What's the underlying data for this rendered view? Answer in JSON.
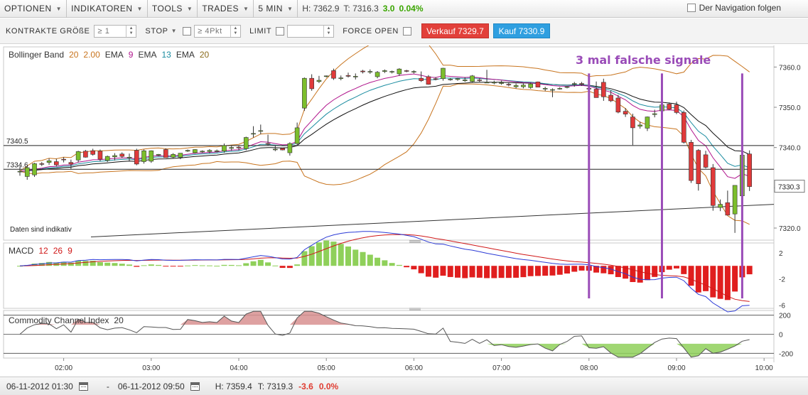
{
  "menu": [
    {
      "label": "OPTIONEN"
    },
    {
      "label": "INDIKATOREN"
    },
    {
      "label": "TOOLS"
    },
    {
      "label": "TRADES"
    },
    {
      "label": "5 MIN"
    }
  ],
  "header_stats": {
    "high": "H: 7362.9",
    "low": "T: 7316.3",
    "change": "3.0",
    "change_pct": "0.04%"
  },
  "nav_follow_label": "Der Navigation folgen",
  "orderbar": {
    "size_label": "KONTRAKTE GRÖßE",
    "size_value": "≥ 1",
    "stop_label": "STOP",
    "stop_value": "≥ 4Pkt",
    "limit_label": "LIMIT",
    "limit_value": "",
    "force_open_label": "FORCE OPEN",
    "sell_button": "Verkauf 7329.7",
    "buy_button": "Kauf 7330.9"
  },
  "panels": {
    "price": {
      "legend": [
        {
          "text": "Bollinger Band",
          "color": "#333333"
        },
        {
          "text": "20",
          "color": "#c8741e"
        },
        {
          "text": "2.00",
          "color": "#c8741e"
        },
        {
          "text": "EMA",
          "color": "#333333"
        },
        {
          "text": "9",
          "color": "#b0148c"
        },
        {
          "text": "EMA",
          "color": "#333333"
        },
        {
          "text": "13",
          "color": "#1a8ca0"
        },
        {
          "text": "EMA",
          "color": "#333333"
        },
        {
          "text": "20",
          "color": "#8a6a1a"
        }
      ],
      "yticks": [
        "7360.0",
        "7350.0",
        "7340.0",
        "7330.0",
        "7320.0"
      ],
      "current_price_label": "7330.3",
      "hline_labels": [
        "7340.5",
        "7334.6"
      ],
      "annotation": "3 mal falsche signale",
      "note": "Daten sind indikativ"
    },
    "macd": {
      "legend": [
        {
          "text": "MACD",
          "color": "#333333"
        },
        {
          "text": "12",
          "color": "#d01818"
        },
        {
          "text": "26",
          "color": "#d01818"
        },
        {
          "text": "9",
          "color": "#d01818"
        }
      ],
      "yticks": [
        "2",
        "-2",
        "-6"
      ]
    },
    "cci": {
      "legend": [
        {
          "text": "Commodity Channel Index",
          "color": "#333333"
        },
        {
          "text": "20",
          "color": "#333333"
        }
      ],
      "yticks": [
        "200",
        "0",
        "-200"
      ]
    }
  },
  "xaxis": {
    "ticks": [
      "02:00",
      "03:00",
      "04:00",
      "05:00",
      "06:00",
      "07:00",
      "08:00",
      "09:00",
      "10:00"
    ]
  },
  "bottombar": {
    "from": "06-11-2012 01:30",
    "separator": "-",
    "to": "06-11-2012 09:50",
    "high": "H: 7359.4",
    "low": "T: 7319.3",
    "change": "-3.6",
    "change_pct": "0.0%"
  },
  "chart_data": {
    "type": "candlestick",
    "interval": "5 MIN",
    "title": "",
    "x_range": [
      "01:30",
      "09:50"
    ],
    "y_range": [
      7317,
      7365
    ],
    "horizontal_lines": [
      7340.5,
      7334.6
    ],
    "current_price": 7330.3,
    "candles": [
      {
        "t": "01:30",
        "o": 7334.1,
        "h": 7335.2,
        "l": 7333.0,
        "c": 7334.1
      },
      {
        "t": "01:35",
        "o": 7332.8,
        "h": 7335.5,
        "l": 7332.0,
        "c": 7335.0
      },
      {
        "t": "01:40",
        "o": 7333.2,
        "h": 7336.2,
        "l": 7332.7,
        "c": 7336.0
      },
      {
        "t": "01:45",
        "o": 7336.0,
        "h": 7336.4,
        "l": 7335.4,
        "c": 7335.9
      },
      {
        "t": "01:50",
        "o": 7336.3,
        "h": 7337.3,
        "l": 7335.7,
        "c": 7336.7
      },
      {
        "t": "01:55",
        "o": 7336.5,
        "h": 7337.2,
        "l": 7335.3,
        "c": 7335.7
      },
      {
        "t": "02:00",
        "o": 7337.1,
        "h": 7337.6,
        "l": 7336.3,
        "c": 7337.0
      },
      {
        "t": "02:05",
        "o": 7336.3,
        "h": 7337.0,
        "l": 7334.7,
        "c": 7335.9
      },
      {
        "t": "02:10",
        "o": 7336.9,
        "h": 7339.2,
        "l": 7336.3,
        "c": 7339.0
      },
      {
        "t": "02:15",
        "o": 7339.1,
        "h": 7339.4,
        "l": 7337.5,
        "c": 7337.6
      },
      {
        "t": "02:20",
        "o": 7339.2,
        "h": 7339.7,
        "l": 7338.0,
        "c": 7338.3
      },
      {
        "t": "02:25",
        "o": 7339.1,
        "h": 7339.5,
        "l": 7336.6,
        "c": 7337.1
      },
      {
        "t": "02:30",
        "o": 7336.8,
        "h": 7338.0,
        "l": 7336.4,
        "c": 7337.8
      },
      {
        "t": "02:35",
        "o": 7337.7,
        "h": 7338.6,
        "l": 7336.8,
        "c": 7338.0
      },
      {
        "t": "02:40",
        "o": 7338.4,
        "h": 7338.8,
        "l": 7337.4,
        "c": 7337.8
      },
      {
        "t": "02:45",
        "o": 7337.4,
        "h": 7338.5,
        "l": 7336.7,
        "c": 7337.6
      },
      {
        "t": "02:50",
        "o": 7339.3,
        "h": 7339.7,
        "l": 7335.6,
        "c": 7335.9
      },
      {
        "t": "02:55",
        "o": 7336.5,
        "h": 7339.5,
        "l": 7336.0,
        "c": 7339.2
      },
      {
        "t": "03:00",
        "o": 7336.6,
        "h": 7339.3,
        "l": 7336.2,
        "c": 7339.2
      },
      {
        "t": "03:05",
        "o": 7338.1,
        "h": 7338.4,
        "l": 7337.9,
        "c": 7338.3
      },
      {
        "t": "03:10",
        "o": 7339.5,
        "h": 7339.8,
        "l": 7337.5,
        "c": 7337.5
      },
      {
        "t": "03:15",
        "o": 7337.6,
        "h": 7338.6,
        "l": 7337.2,
        "c": 7338.3
      },
      {
        "t": "03:20",
        "o": 7337.6,
        "h": 7338.6,
        "l": 7337.1,
        "c": 7338.6
      },
      {
        "t": "03:25",
        "o": 7339.1,
        "h": 7339.5,
        "l": 7338.9,
        "c": 7339.3
      },
      {
        "t": "03:30",
        "o": 7338.7,
        "h": 7339.6,
        "l": 7338.5,
        "c": 7339.5
      },
      {
        "t": "03:35",
        "o": 7338.9,
        "h": 7339.3,
        "l": 7338.7,
        "c": 7339.1
      },
      {
        "t": "03:40",
        "o": 7339.0,
        "h": 7339.6,
        "l": 7338.6,
        "c": 7339.3
      },
      {
        "t": "03:45",
        "o": 7339.1,
        "h": 7339.5,
        "l": 7338.8,
        "c": 7339.2
      },
      {
        "t": "03:50",
        "o": 7339.1,
        "h": 7341.0,
        "l": 7338.7,
        "c": 7340.5
      },
      {
        "t": "03:55",
        "o": 7339.8,
        "h": 7340.4,
        "l": 7339.2,
        "c": 7340.0
      },
      {
        "t": "04:00",
        "o": 7340.1,
        "h": 7340.5,
        "l": 7339.3,
        "c": 7339.9
      },
      {
        "t": "04:05",
        "o": 7339.7,
        "h": 7342.7,
        "l": 7339.3,
        "c": 7342.5
      },
      {
        "t": "04:10",
        "o": 7343.4,
        "h": 7345.3,
        "l": 7342.5,
        "c": 7343.5
      },
      {
        "t": "04:15",
        "o": 7344.2,
        "h": 7345.7,
        "l": 7343.3,
        "c": 7344.2
      },
      {
        "t": "04:20",
        "o": 7341.0,
        "h": 7343.2,
        "l": 7340.5,
        "c": 7340.9
      },
      {
        "t": "04:25",
        "o": 7339.6,
        "h": 7340.4,
        "l": 7339.1,
        "c": 7339.6
      },
      {
        "t": "04:30",
        "o": 7339.8,
        "h": 7339.9,
        "l": 7339.3,
        "c": 7339.4
      },
      {
        "t": "04:35",
        "o": 7338.7,
        "h": 7341.3,
        "l": 7338.0,
        "c": 7341.0
      },
      {
        "t": "04:40",
        "o": 7341.0,
        "h": 7346.2,
        "l": 7340.4,
        "c": 7344.9
      },
      {
        "t": "04:45",
        "o": 7349.8,
        "h": 7357.4,
        "l": 7349.1,
        "c": 7357.2
      },
      {
        "t": "04:50",
        "o": 7357.2,
        "h": 7358.2,
        "l": 7354.1,
        "c": 7354.6
      },
      {
        "t": "04:55",
        "o": 7356.4,
        "h": 7357.8,
        "l": 7356.0,
        "c": 7356.7
      },
      {
        "t": "05:00",
        "o": 7357.8,
        "h": 7357.9,
        "l": 7357.4,
        "c": 7357.8
      },
      {
        "t": "05:05",
        "o": 7359.1,
        "h": 7359.6,
        "l": 7356.8,
        "c": 7357.2
      },
      {
        "t": "05:10",
        "o": 7357.3,
        "h": 7357.9,
        "l": 7356.7,
        "c": 7357.3
      },
      {
        "t": "05:15",
        "o": 7357.9,
        "h": 7358.6,
        "l": 7357.4,
        "c": 7357.7
      },
      {
        "t": "05:20",
        "o": 7357.6,
        "h": 7358.4,
        "l": 7356.9,
        "c": 7357.7
      },
      {
        "t": "05:25",
        "o": 7359.0,
        "h": 7359.3,
        "l": 7358.4,
        "c": 7358.8
      },
      {
        "t": "05:30",
        "o": 7358.8,
        "h": 7359.4,
        "l": 7358.3,
        "c": 7358.9
      },
      {
        "t": "05:35",
        "o": 7357.6,
        "h": 7359.0,
        "l": 7357.2,
        "c": 7358.7
      },
      {
        "t": "05:40",
        "o": 7358.9,
        "h": 7359.4,
        "l": 7358.5,
        "c": 7359.1
      },
      {
        "t": "05:45",
        "o": 7358.8,
        "h": 7359.1,
        "l": 7358.4,
        "c": 7358.9
      },
      {
        "t": "05:50",
        "o": 7358.3,
        "h": 7359.7,
        "l": 7357.8,
        "c": 7359.5
      },
      {
        "t": "05:55",
        "o": 7359.1,
        "h": 7359.3,
        "l": 7358.7,
        "c": 7359.0
      },
      {
        "t": "06:00",
        "o": 7358.9,
        "h": 7359.2,
        "l": 7358.4,
        "c": 7358.9
      },
      {
        "t": "06:05",
        "o": 7357.2,
        "h": 7358.9,
        "l": 7356.3,
        "c": 7356.6
      },
      {
        "t": "06:10",
        "o": 7357.6,
        "h": 7358.0,
        "l": 7355.6,
        "c": 7355.7
      },
      {
        "t": "06:15",
        "o": 7357.1,
        "h": 7357.5,
        "l": 7356.7,
        "c": 7357.0
      },
      {
        "t": "06:20",
        "o": 7357.1,
        "h": 7359.8,
        "l": 7356.6,
        "c": 7359.7
      },
      {
        "t": "06:25",
        "o": 7357.0,
        "h": 7357.3,
        "l": 7356.6,
        "c": 7357.0
      },
      {
        "t": "06:30",
        "o": 7356.9,
        "h": 7357.3,
        "l": 7356.6,
        "c": 7357.1
      },
      {
        "t": "06:35",
        "o": 7356.6,
        "h": 7357.5,
        "l": 7356.3,
        "c": 7356.8
      },
      {
        "t": "06:40",
        "o": 7356.4,
        "h": 7358.0,
        "l": 7356.2,
        "c": 7357.8
      },
      {
        "t": "06:45",
        "o": 7356.8,
        "h": 7357.2,
        "l": 7356.2,
        "c": 7356.7
      },
      {
        "t": "06:50",
        "o": 7356.2,
        "h": 7359.3,
        "l": 7356.0,
        "c": 7356.2
      },
      {
        "t": "06:55",
        "o": 7356.1,
        "h": 7356.6,
        "l": 7355.7,
        "c": 7356.2
      },
      {
        "t": "07:00",
        "o": 7355.9,
        "h": 7356.6,
        "l": 7355.6,
        "c": 7356.1
      },
      {
        "t": "07:05",
        "o": 7355.7,
        "h": 7356.1,
        "l": 7355.2,
        "c": 7355.6
      },
      {
        "t": "07:10",
        "o": 7355.1,
        "h": 7355.9,
        "l": 7354.7,
        "c": 7355.4
      },
      {
        "t": "07:15",
        "o": 7355.1,
        "h": 7355.9,
        "l": 7354.7,
        "c": 7355.5
      },
      {
        "t": "07:20",
        "o": 7354.9,
        "h": 7356.1,
        "l": 7354.6,
        "c": 7355.8
      },
      {
        "t": "07:25",
        "o": 7356.3,
        "h": 7356.4,
        "l": 7355.0,
        "c": 7355.0
      },
      {
        "t": "07:30",
        "o": 7354.6,
        "h": 7355.1,
        "l": 7354.0,
        "c": 7354.7
      },
      {
        "t": "07:35",
        "o": 7354.4,
        "h": 7354.7,
        "l": 7352.5,
        "c": 7354.4
      },
      {
        "t": "07:40",
        "o": 7354.7,
        "h": 7355.0,
        "l": 7354.4,
        "c": 7354.7
      },
      {
        "t": "07:45",
        "o": 7355.1,
        "h": 7355.3,
        "l": 7354.7,
        "c": 7355.1
      },
      {
        "t": "07:50",
        "o": 7355.9,
        "h": 7356.3,
        "l": 7355.1,
        "c": 7355.9
      },
      {
        "t": "07:55",
        "o": 7355.9,
        "h": 7356.3,
        "l": 7355.3,
        "c": 7355.7
      },
      {
        "t": "08:00",
        "o": 7354.7,
        "h": 7355.3,
        "l": 7352.2,
        "c": 7354.6
      },
      {
        "t": "08:05",
        "o": 7354.5,
        "h": 7356.4,
        "l": 7352.4,
        "c": 7352.4
      },
      {
        "t": "08:10",
        "o": 7356.2,
        "h": 7357.1,
        "l": 7351.6,
        "c": 7352.6
      },
      {
        "t": "08:15",
        "o": 7353.0,
        "h": 7354.2,
        "l": 7351.3,
        "c": 7351.6
      },
      {
        "t": "08:20",
        "o": 7352.3,
        "h": 7353.1,
        "l": 7348.5,
        "c": 7348.8
      },
      {
        "t": "08:25",
        "o": 7349.0,
        "h": 7349.8,
        "l": 7347.6,
        "c": 7348.3
      },
      {
        "t": "08:30",
        "o": 7347.6,
        "h": 7348.4,
        "l": 7340.6,
        "c": 7344.9
      },
      {
        "t": "08:35",
        "o": 7345.3,
        "h": 7346.4,
        "l": 7344.7,
        "c": 7345.6
      },
      {
        "t": "08:40",
        "o": 7344.8,
        "h": 7347.7,
        "l": 7344.1,
        "c": 7347.6
      },
      {
        "t": "08:45",
        "o": 7348.2,
        "h": 7349.4,
        "l": 7347.5,
        "c": 7348.4
      },
      {
        "t": "08:50",
        "o": 7349.1,
        "h": 7350.8,
        "l": 7348.0,
        "c": 7350.6
      },
      {
        "t": "08:55",
        "o": 7350.8,
        "h": 7351.2,
        "l": 7349.3,
        "c": 7349.5
      },
      {
        "t": "09:00",
        "o": 7350.6,
        "h": 7351.4,
        "l": 7348.3,
        "c": 7348.7
      },
      {
        "t": "09:05",
        "o": 7348.7,
        "h": 7349.2,
        "l": 7341.0,
        "c": 7341.3
      },
      {
        "t": "09:10",
        "o": 7341.3,
        "h": 7341.9,
        "l": 7331.2,
        "c": 7331.8
      },
      {
        "t": "09:15",
        "o": 7339.3,
        "h": 7339.6,
        "l": 7329.3,
        "c": 7331.0
      },
      {
        "t": "09:20",
        "o": 7338.2,
        "h": 7339.2,
        "l": 7334.8,
        "c": 7335.1
      },
      {
        "t": "09:25",
        "o": 7335.0,
        "h": 7335.9,
        "l": 7324.3,
        "c": 7325.6
      },
      {
        "t": "09:30",
        "o": 7325.1,
        "h": 7327.1,
        "l": 7324.2,
        "c": 7325.9
      },
      {
        "t": "09:35",
        "o": 7326.3,
        "h": 7329.3,
        "l": 7323.2,
        "c": 7323.2
      },
      {
        "t": "09:40",
        "o": 7323.5,
        "h": 7329.7,
        "l": 7318.8,
        "c": 7330.6
      },
      {
        "t": "09:45",
        "o": 7328.0,
        "h": 7331.8,
        "l": 7325.1,
        "c": 7338.1
      },
      {
        "t": "09:50",
        "o": 7338.4,
        "h": 7339.3,
        "l": 7329.2,
        "c": 7330.3
      }
    ],
    "indicators": [
      {
        "name": "Bollinger Band",
        "params": [
          20,
          2.0
        ]
      },
      {
        "name": "EMA",
        "params": [
          9
        ]
      },
      {
        "name": "EMA",
        "params": [
          13
        ]
      },
      {
        "name": "EMA",
        "params": [
          20
        ]
      },
      {
        "name": "MACD",
        "params": [
          12,
          26,
          9
        ],
        "y_range": [
          -6.5,
          3.5
        ]
      },
      {
        "name": "Commodity Channel Index",
        "params": [
          20
        ],
        "y_range": [
          -250,
          250
        ],
        "ref_lines": [
          200,
          0,
          -200
        ]
      }
    ],
    "colors": {
      "bullish": "#7cbe2c",
      "bearish": "#e03a3a",
      "bollinger": "#c8741e",
      "ema9": "#b0148c",
      "ema13": "#1a8ca0",
      "ema20": "#8a6a1a",
      "macd_line": "#2b3ad6",
      "signal_line": "#d01818",
      "cci_pos": "#d89090",
      "cci_neg": "#8fd05a",
      "annotation": "#9a4cb8"
    },
    "signal_marker_times": [
      "08:00",
      "08:50",
      "09:45"
    ]
  }
}
